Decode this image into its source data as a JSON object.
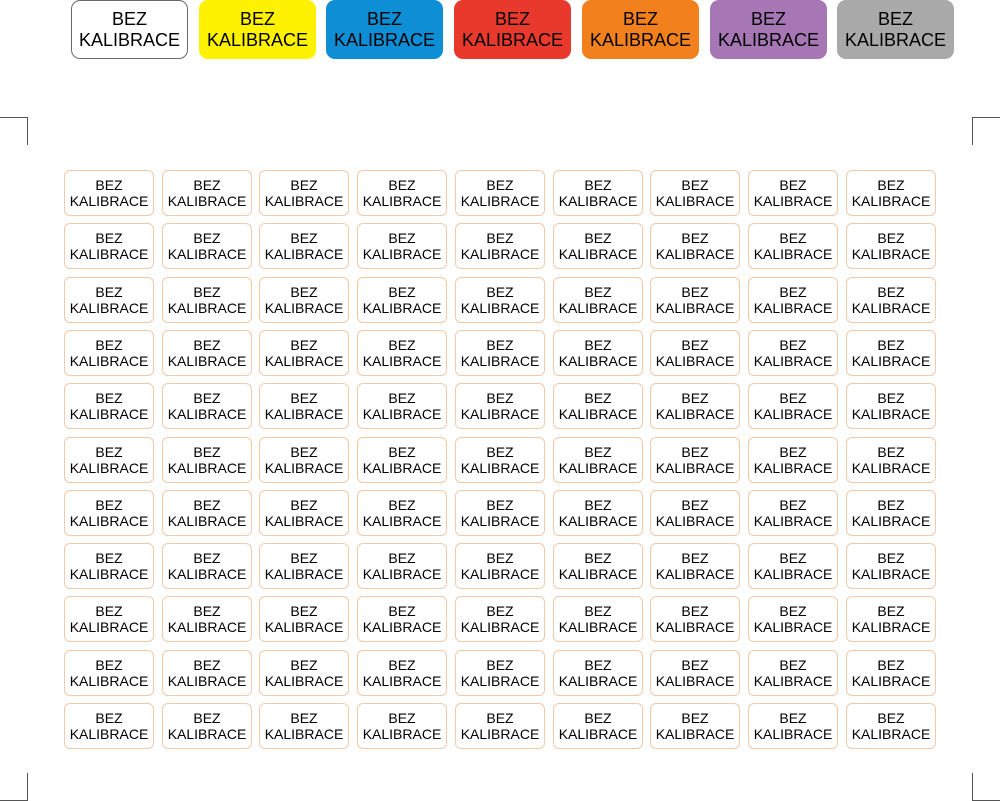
{
  "label_text": {
    "line1": "BEZ",
    "line2": "KALIBRACE"
  },
  "color_variants": [
    {
      "name": "white",
      "background": "#ffffff",
      "outlined": true
    },
    {
      "name": "yellow",
      "background": "#fff200",
      "outlined": false
    },
    {
      "name": "blue",
      "background": "#0d8ed5",
      "outlined": false
    },
    {
      "name": "red",
      "background": "#e8392c",
      "outlined": false
    },
    {
      "name": "orange",
      "background": "#f2811d",
      "outlined": false
    },
    {
      "name": "purple",
      "background": "#a676b5",
      "outlined": false
    },
    {
      "name": "gray",
      "background": "#a9a9a9",
      "outlined": false
    }
  ],
  "sheet": {
    "rows": 11,
    "columns": 9,
    "label_border_color": "#f3c9a8"
  },
  "crop_mark_color": "#555555"
}
